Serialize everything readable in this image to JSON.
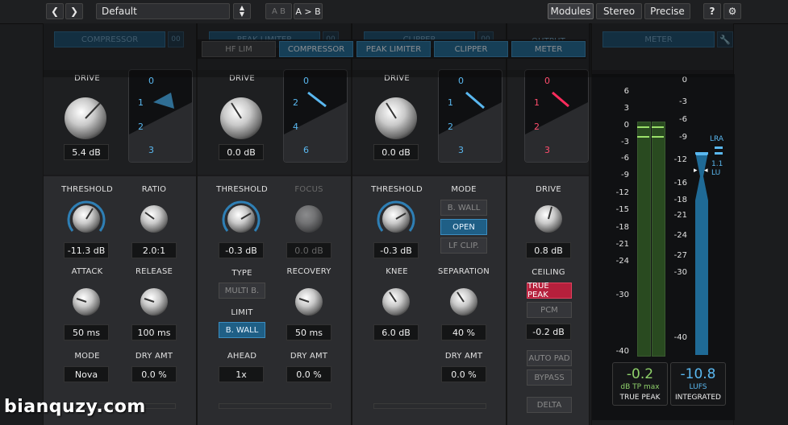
{
  "topbar": {
    "back_icon": "arrow-left-icon",
    "forward_icon": "arrow-right-icon",
    "preset": "Default",
    "ab_a": "A B",
    "ab_copy": "A > B",
    "modules": "Modules",
    "stereo": "Stereo",
    "precise": "Precise",
    "help": "?",
    "settings_icon": "gear-icon"
  },
  "module_tabs": [
    "HF LIM",
    "COMPRESSOR",
    "PEAK LIMITER",
    "CLIPPER",
    "METER"
  ],
  "compressor": {
    "header": "COMPRESSOR",
    "num": "00",
    "drive_label": "DRIVE",
    "drive_value": "5.4 dB",
    "gr_ticks": [
      "0",
      "1",
      "2",
      "3"
    ],
    "threshold_label": "THRESHOLD",
    "threshold_value": "-11.3 dB",
    "ratio_label": "RATIO",
    "ratio_value": "2.0:1",
    "attack_label": "ATTACK",
    "attack_value": "50 ms",
    "release_label": "RELEASE",
    "release_value": "100 ms",
    "mode_label": "MODE",
    "mode_value": "Nova",
    "dry_label": "DRY AMT",
    "dry_value": "0.0 %"
  },
  "peak_limiter": {
    "header": "PEAK LIMITER",
    "num": "00",
    "drive_label": "DRIVE",
    "drive_value": "0.0 dB",
    "gr_ticks": [
      "0",
      "2",
      "4",
      "6"
    ],
    "threshold_label": "THRESHOLD",
    "threshold_value": "-0.3 dB",
    "focus_label": "FOCUS",
    "focus_value": "0.0 dB",
    "type_label": "TYPE",
    "type_value": "MULTI B.",
    "limit_label": "LIMIT",
    "limit_value": "B. WALL",
    "recovery_label": "RECOVERY",
    "recovery_value": "50 ms",
    "ahead_label": "AHEAD",
    "ahead_value": "1x",
    "dry_label": "DRY AMT",
    "dry_value": "0.0 %"
  },
  "clipper": {
    "header": "CLIPPER",
    "num": "00",
    "drive_label": "DRIVE",
    "drive_value": "0.0 dB",
    "gr_ticks": [
      "0",
      "1",
      "2",
      "3"
    ],
    "threshold_label": "THRESHOLD",
    "threshold_value": "-0.3 dB",
    "mode_label": "MODE",
    "mode_options": [
      "B. WALL",
      "OPEN",
      "LF CLIP."
    ],
    "knee_label": "KNEE",
    "knee_value": "6.0 dB",
    "separation_label": "SEPARATION",
    "separation_value": "40 %",
    "dry_label": "DRY AMT",
    "dry_value": "0.0 %"
  },
  "output": {
    "header": "OUTPUT",
    "gr_ticks": [
      "0",
      "1",
      "2",
      "3"
    ],
    "drive_label": "DRIVE",
    "drive_value": "0.8 dB",
    "ceiling_label": "CEILING",
    "true_peak": "TRUE PEAK",
    "pcm": "PCM",
    "ceiling_value": "-0.2 dB",
    "auto_pad": "AUTO PAD",
    "bypass": "BYPASS",
    "delta": "DELTA"
  },
  "meter": {
    "header": "METER",
    "wrench_icon": "wrench-icon",
    "left_scale": [
      "6",
      "3",
      "0",
      "-3",
      "-6",
      "-9",
      "-12",
      "-15",
      "-18",
      "-21",
      "-24",
      "-30",
      "-40"
    ],
    "right_scale": [
      "0",
      "-3",
      "-6",
      "-9",
      "-12",
      "-16",
      "-18",
      "-21",
      "-24",
      "-27",
      "-30",
      "-40"
    ],
    "lra_label": "LRA",
    "lra_value": "1.1",
    "lra_unit": "LU",
    "true_peak_value": "-0.2",
    "true_peak_unit": "dB TP max",
    "true_peak_label": "TRUE PEAK",
    "lufs_value": "-10.8",
    "lufs_unit": "LUFS",
    "lufs_label": "INTEGRATED"
  },
  "watermark": "bianquzy.com",
  "colors": {
    "accent": "#3b8dc0",
    "red": "#e2415f",
    "green": "#8fd16a",
    "lufs": "#5ab8f0"
  }
}
